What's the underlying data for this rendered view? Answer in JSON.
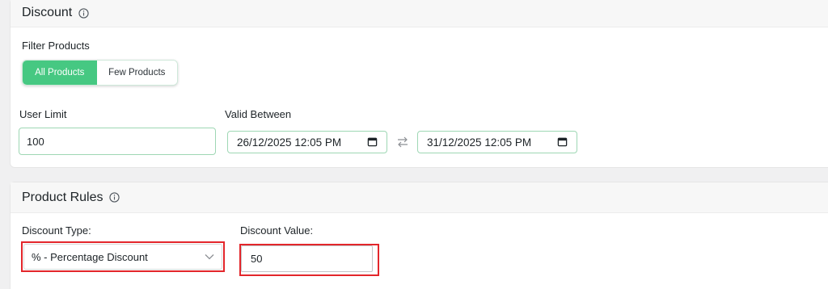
{
  "discount_section": {
    "title": "Discount",
    "filter_label": "Filter Products",
    "filter_options": [
      "All Products",
      "Few Products"
    ],
    "filter_selected": "All Products",
    "user_limit_label": "User Limit",
    "user_limit_value": "100",
    "valid_between_label": "Valid Between",
    "valid_from": "26/12/2025 12:05 PM",
    "valid_to": "31/12/2025 12:05 PM"
  },
  "product_rules_section": {
    "title": "Product Rules",
    "discount_type_label": "Discount Type:",
    "discount_type_value": "% - Percentage Discount",
    "discount_value_label": "Discount Value:",
    "discount_value": "50"
  },
  "colors": {
    "accent_green": "#46c882",
    "highlight_red": "#e3262b"
  },
  "icons": [
    "info-icon",
    "calendar-icon",
    "swap-arrows-icon",
    "chevron-down-icon"
  ]
}
